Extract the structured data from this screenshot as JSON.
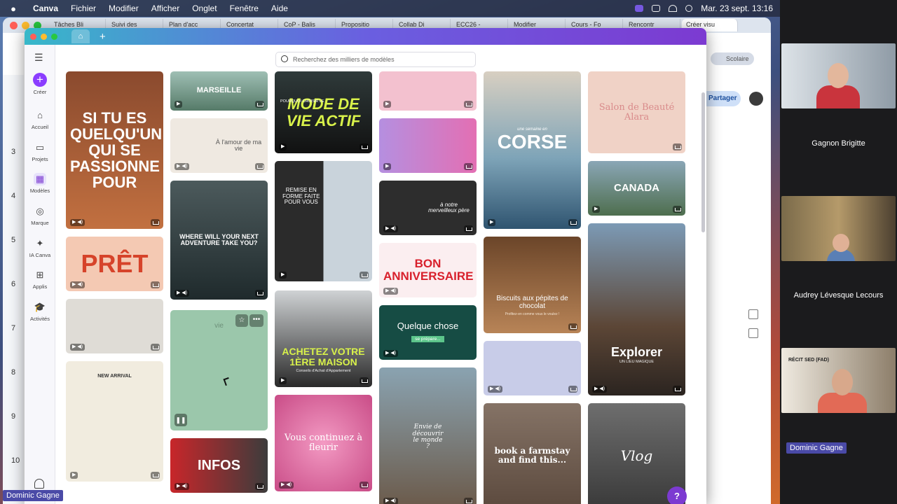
{
  "macos_menubar": {
    "app": "Canva",
    "menus": [
      "Fichier",
      "Modifier",
      "Afficher",
      "Onglet",
      "Fenêtre",
      "Aide"
    ],
    "clock": "Mar. 23 sept. 13:16"
  },
  "browser": {
    "tabs": [
      "Tâches Bli",
      "Suivi des",
      "Plan d'acc",
      "Concertat",
      "CoP - Balis",
      "Propositio",
      "Collab Di",
      "ECC26 -",
      "Modifier",
      "Cours - Fo",
      "Rencontr",
      "Créer visu"
    ],
    "share_label": "Partager",
    "profile_label": "Scolaire",
    "line_numbers": [
      "3",
      "4",
      "5",
      "6",
      "7",
      "8",
      "9",
      "10"
    ]
  },
  "canva": {
    "search_placeholder": "Recherchez des milliers de modèles",
    "rail": {
      "create": "Créer",
      "home": "Accueil",
      "projects": "Projets",
      "templates": "Modèles",
      "brand": "Marque",
      "ai": "IA Canva",
      "apps": "Applis",
      "activities": "Activités"
    },
    "card_texts": {
      "passion": "SI TU ES QUELQU'UN QUI SE PASSIONNE POUR",
      "pret": "PRÊT",
      "new_arrival": "NEW ARRIVAL",
      "marseille": "MARSEILLE",
      "amour": "À l'amour de ma vie",
      "adventure": "WHERE WILL YOUR NEXT ADVENTURE TAKE YOU?",
      "vie": "vie",
      "infos": "INFOS",
      "mode_vie": "MODE DE VIE ACTIF",
      "mode_vie_small": "POURQUOI CHOISIR LE",
      "remise": "REMISE EN FORME FAITE POUR VOUS",
      "maison": "ACHETEZ VOTRE 1ÈRE MAISON",
      "maison_sub": "Conseils d'Achat d'Appartement",
      "fleurir": "Vous continuez à fleurir",
      "pere": "à notre merveilleux père",
      "anniv": "BON ANNIVERSAIRE",
      "quelque": "Quelque chose",
      "prepare": "se prépare...",
      "envie": "Envie de découvrir le monde ?",
      "corse": "CORSE",
      "corse_small": "une semaine en",
      "biscuits": "Biscuits aux pépites de chocolat",
      "biscuits_sub": "Profitez-en comme vous le voulez !",
      "farmstay": "book a farmstay and find this...",
      "salon": "Salon de Beauté Alara",
      "canada": "CANADA",
      "explorer": "Explorer",
      "explorer_sub": "UN LIEU MAGIQUE",
      "vlog": "Vlog"
    },
    "help": "?"
  },
  "meeting": {
    "participants": [
      {
        "name": "Gagnon Brigitte"
      },
      {
        "name": "Audrey Lévesque Lecours"
      },
      {
        "name": "Dominic Gagne",
        "tile_caption": "RÉCIT SED (FAD)"
      }
    ],
    "self_name": "Dominic Gagne"
  },
  "colors": {
    "canva_purple": "#7c3ad1",
    "zoom_tag": "#4a4aa7"
  }
}
